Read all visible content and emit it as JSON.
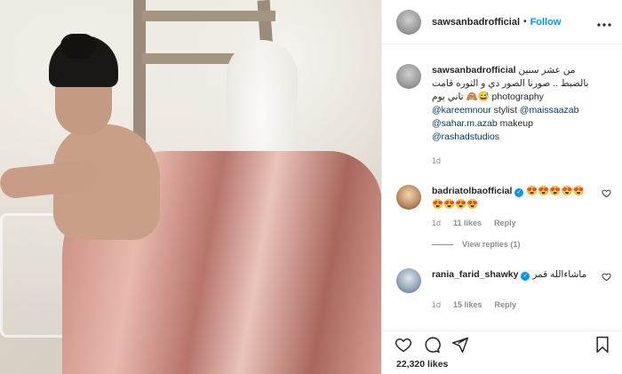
{
  "post": {
    "username": "sawsanbadrofficial",
    "follow_label": "Follow",
    "separator": "•",
    "caption_line1": "من عشر سنين",
    "caption_line2": "بالضبط .. صورنا الصور دي و الثوره قامت",
    "caption_line3": "تاني يوم 🙈😅 photography",
    "mention_photographer": "@kareemnour",
    "word_stylist": "stylist",
    "mention_stylist": "@maissaazab",
    "mention_makeup_artist": "@sahar.m.azab",
    "word_makeup": "makeup",
    "mention_studio": "@rashadstudios",
    "time": "1d",
    "likes": "22,320 likes"
  },
  "comments": [
    {
      "username": "badriatolbaofficial",
      "text": "😍😍😍😍😍😍😍😍😍",
      "time": "1d",
      "likes": "11 likes",
      "reply": "Reply",
      "view_replies": "View replies (1)"
    },
    {
      "username": "rania_farid_shawky",
      "text": "ماشاءالله قمر",
      "time": "1d",
      "likes": "15 likes",
      "reply": "Reply"
    }
  ],
  "icons": {
    "more": "more-icon",
    "heart": "heart-icon",
    "comment": "comment-icon",
    "share": "share-icon",
    "bookmark": "bookmark-icon",
    "verified": "verified-icon"
  },
  "colors": {
    "accent": "#0095f6",
    "muted": "#8e8e8e",
    "text": "#262626"
  }
}
